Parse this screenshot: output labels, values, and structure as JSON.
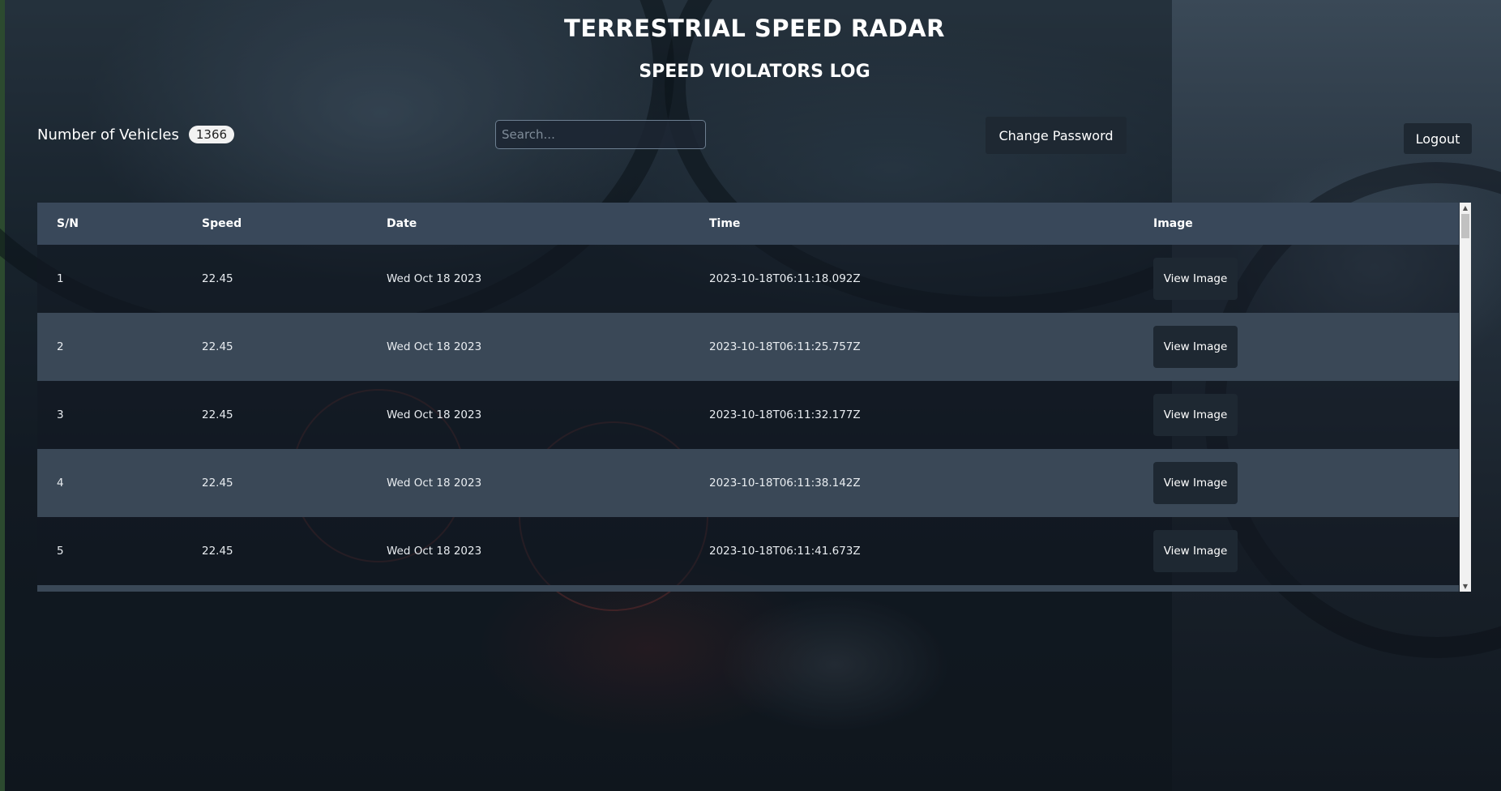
{
  "header": {
    "title": "TERRESTRIAL SPEED RADAR",
    "subtitle": "SPEED VIOLATORS LOG"
  },
  "controls": {
    "count_label": "Number of Vehicles",
    "count_value": "1366",
    "search_placeholder": "Search...",
    "search_value": "",
    "change_password_label": "Change Password",
    "logout_label": "Logout"
  },
  "table": {
    "columns": [
      "S/N",
      "Speed",
      "Date",
      "Time",
      "Image"
    ],
    "rows": [
      {
        "sn": "1",
        "speed": "22.45",
        "date": "Wed Oct 18 2023",
        "time": "2023-10-18T06:11:18.092Z",
        "action": "View Image"
      },
      {
        "sn": "2",
        "speed": "22.45",
        "date": "Wed Oct 18 2023",
        "time": "2023-10-18T06:11:25.757Z",
        "action": "View Image"
      },
      {
        "sn": "3",
        "speed": "22.45",
        "date": "Wed Oct 18 2023",
        "time": "2023-10-18T06:11:32.177Z",
        "action": "View Image"
      },
      {
        "sn": "4",
        "speed": "22.45",
        "date": "Wed Oct 18 2023",
        "time": "2023-10-18T06:11:38.142Z",
        "action": "View Image"
      },
      {
        "sn": "5",
        "speed": "22.45",
        "date": "Wed Oct 18 2023",
        "time": "2023-10-18T06:11:41.673Z",
        "action": "View Image"
      }
    ]
  },
  "scrollbar": {
    "up_icon": "triangle-up-icon",
    "down_icon": "triangle-down-icon"
  },
  "colors": {
    "header_row": "#39485a",
    "alt_row": "#3a4857",
    "button_bg": "#1e2832",
    "badge_bg": "#f2f2f2"
  }
}
